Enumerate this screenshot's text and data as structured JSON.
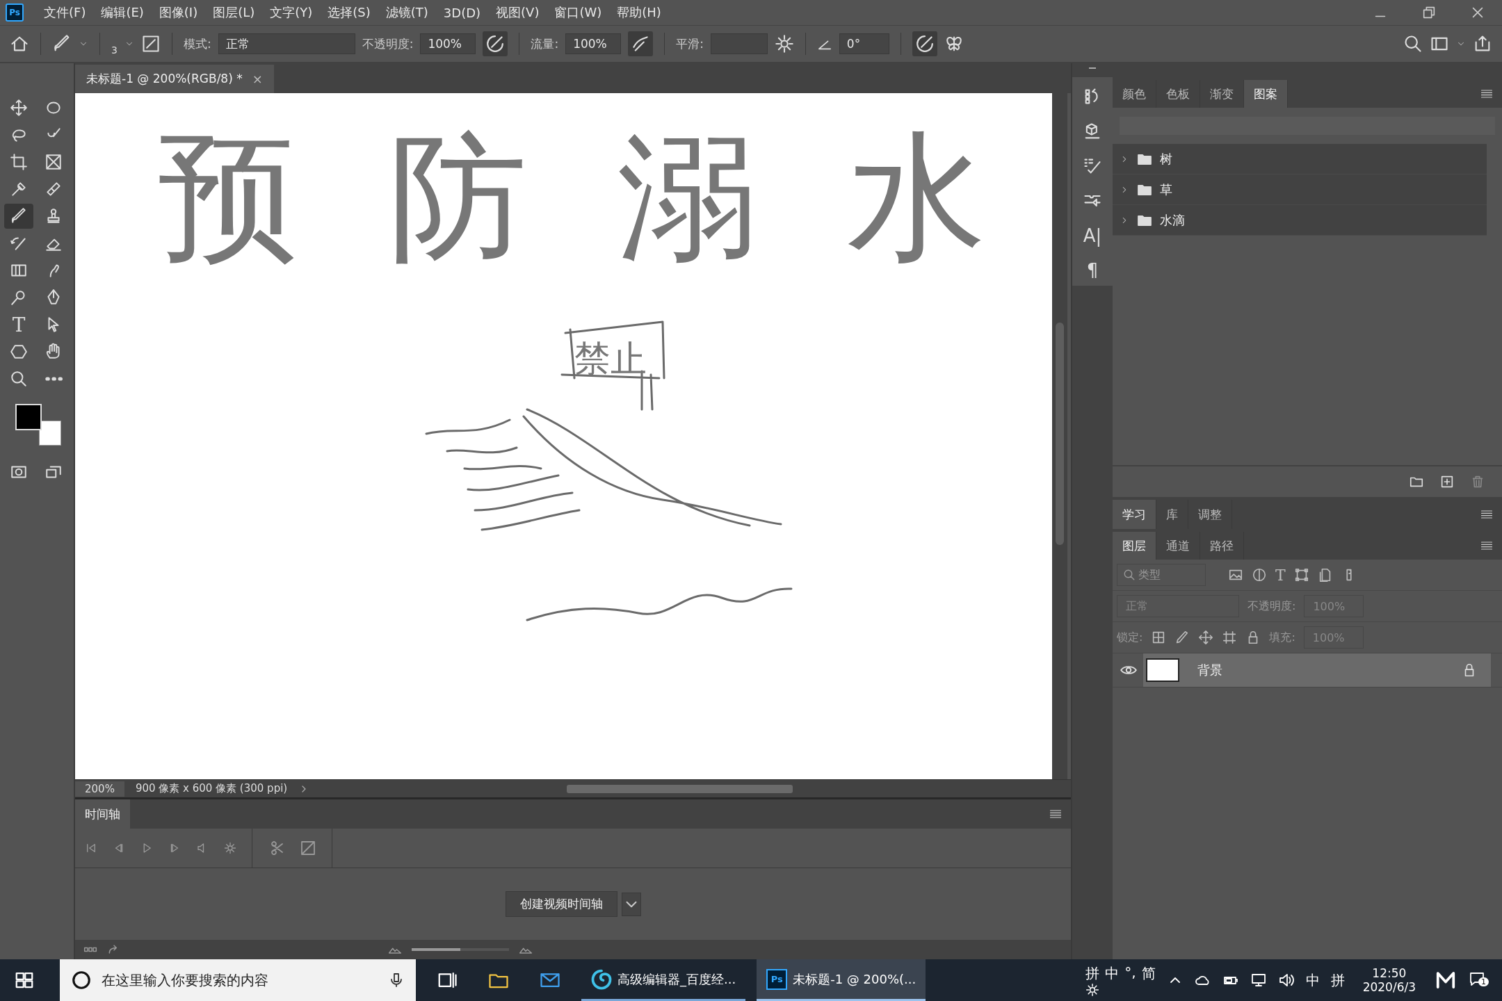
{
  "app": {
    "logo": "Ps"
  },
  "menu": [
    "文件(F)",
    "编辑(E)",
    "图像(I)",
    "图层(L)",
    "文字(Y)",
    "选择(S)",
    "滤镜(T)",
    "3D(D)",
    "视图(V)",
    "窗口(W)",
    "帮助(H)"
  ],
  "options_bar": {
    "brush_size": "3",
    "mode_label": "模式:",
    "mode": "正常",
    "opacity_label": "不透明度:",
    "opacity": "100%",
    "flow_label": "流量:",
    "flow": "100%",
    "smoothing_label": "平滑:",
    "angle": "0°"
  },
  "tools": [
    {
      "kind": "move",
      "selected": false
    },
    {
      "kind": "marquee",
      "selected": false
    },
    {
      "kind": "lasso",
      "selected": false
    },
    {
      "kind": "quick-select",
      "selected": false
    },
    {
      "kind": "crop",
      "selected": false
    },
    {
      "kind": "frame",
      "selected": false
    },
    {
      "kind": "eyedropper",
      "selected": false
    },
    {
      "kind": "healing",
      "selected": false
    },
    {
      "kind": "brush",
      "selected": true
    },
    {
      "kind": "stamp",
      "selected": false
    },
    {
      "kind": "history-brush",
      "selected": false
    },
    {
      "kind": "eraser",
      "selected": false
    },
    {
      "kind": "gradient",
      "selected": false
    },
    {
      "kind": "smudge",
      "selected": false
    },
    {
      "kind": "dodge",
      "selected": false
    },
    {
      "kind": "pen",
      "selected": false
    },
    {
      "kind": "type",
      "selected": false,
      "glyph": "T"
    },
    {
      "kind": "path-select",
      "selected": false
    },
    {
      "kind": "shape",
      "selected": false
    },
    {
      "kind": "hand",
      "selected": false
    },
    {
      "kind": "zoom",
      "selected": false
    },
    {
      "kind": "more",
      "selected": false
    }
  ],
  "document_tab": {
    "title": "未标题-1 @ 200%(RGB/8) *",
    "close": "×"
  },
  "canvas": {
    "title_text": "预防溺水",
    "sign_text": "禁止"
  },
  "status_bar": {
    "zoom": "200%",
    "size": "900 像素 x 600 像素 (300 ppi)"
  },
  "timeline": {
    "tab": "时间轴",
    "create_button": "创建视频时间轴",
    "zoom_slider": {
      "level": 0.5
    }
  },
  "side_strip": [
    {
      "kind": "history"
    },
    {
      "kind": "cube"
    },
    {
      "kind": "brush-settings"
    },
    {
      "kind": "brush-presets"
    },
    {
      "kind": "character",
      "glyph": "A|"
    },
    {
      "kind": "paragraph",
      "glyph": "¶"
    }
  ],
  "patterns_panel": {
    "tabs": [
      {
        "label": "颜色",
        "selected": false
      },
      {
        "label": "色板",
        "selected": false
      },
      {
        "label": "渐变",
        "selected": false
      },
      {
        "label": "图案",
        "selected": true
      }
    ],
    "groups": [
      {
        "name": "树",
        "expanded": false
      },
      {
        "name": "草",
        "expanded": false
      },
      {
        "name": "水滴",
        "expanded": false
      }
    ]
  },
  "learn_panel": {
    "tabs": [
      {
        "label": "学习",
        "selected": true
      },
      {
        "label": "库",
        "selected": false
      },
      {
        "label": "调整",
        "selected": false
      }
    ]
  },
  "layers_panel": {
    "tabs": [
      {
        "label": "图层",
        "selected": true
      },
      {
        "label": "通道",
        "selected": false
      },
      {
        "label": "路径",
        "selected": false
      }
    ],
    "filter_placeholder": "类型",
    "type_filter_glyph": "T",
    "blend_mode": "正常",
    "opacity_label": "不透明度:",
    "opacity": "100%",
    "lock_label": "锁定:",
    "fill_label": "填充:",
    "fill": "100%",
    "layers": [
      {
        "name": "背景",
        "visible": true,
        "locked": true,
        "selected": true
      }
    ]
  },
  "taskbar": {
    "search_placeholder": "在这里输入你要搜索的内容",
    "apps": [
      {
        "kind": "browser",
        "label": "高级编辑器_百度经...",
        "active": false
      },
      {
        "kind": "photoshop",
        "label": "未标题-1 @ 200%(...",
        "active": true,
        "logo": "Ps"
      }
    ],
    "ime": [
      "拼",
      "中",
      "°,",
      "简"
    ],
    "tray_ime": "中",
    "tray_pinyin": "拼",
    "time": "12:50",
    "date": "2020/6/3",
    "notifications": "1"
  }
}
